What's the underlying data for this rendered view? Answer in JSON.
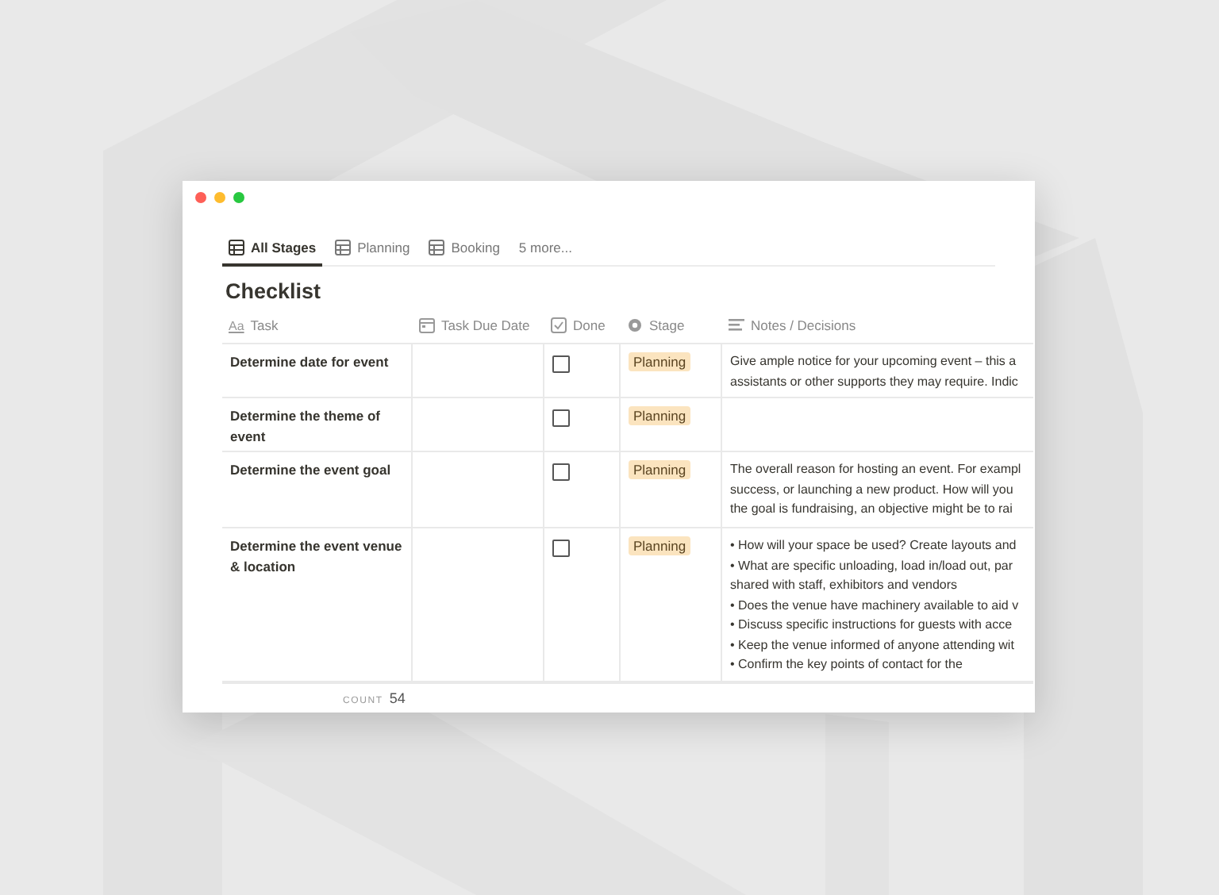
{
  "tabs": [
    {
      "label": "All Stages",
      "selected": true,
      "kind": "view"
    },
    {
      "label": "Planning",
      "selected": false,
      "kind": "view"
    },
    {
      "label": "Booking",
      "selected": false,
      "kind": "view"
    },
    {
      "label": "5 more...",
      "selected": false,
      "kind": "more"
    }
  ],
  "title": "Checklist",
  "columns": [
    {
      "label": "Task",
      "kind": "title",
      "icon_label": "Aa"
    },
    {
      "label": "Task Due Date",
      "kind": "date"
    },
    {
      "label": "Done",
      "kind": "checkbox"
    },
    {
      "label": "Stage",
      "kind": "select"
    },
    {
      "label": "Notes / Decisions",
      "kind": "text"
    }
  ],
  "rows": [
    {
      "task": "Determine date for event",
      "done": false,
      "stage": "Planning",
      "notes": [
        "Give ample notice for your upcoming event – this a",
        "assistants or other supports they may require. Indic"
      ]
    },
    {
      "task": "Determine the theme of event",
      "done": false,
      "stage": "Planning",
      "notes": []
    },
    {
      "task": "Determine the event goal",
      "done": false,
      "stage": "Planning",
      "notes": [
        "The overall reason for hosting an event. For exampl",
        "success, or launching a new product. How will you",
        "the goal is fundraising, an objective might be to rai"
      ]
    },
    {
      "task": "Determine the event venue & location",
      "done": false,
      "stage": "Planning",
      "notes": [
        "• How will your space be used? Create layouts and",
        "• What are specific unloading, load in/load out, par",
        "shared with staff, exhibitors and vendors",
        "• Does the venue have machinery available to aid v",
        "• Discuss specific instructions for guests with acce",
        "• Keep the venue informed of anyone attending wit",
        "• Confirm the key points of contact for the"
      ]
    }
  ],
  "footer": {
    "label": "COUNT",
    "value": "54"
  }
}
